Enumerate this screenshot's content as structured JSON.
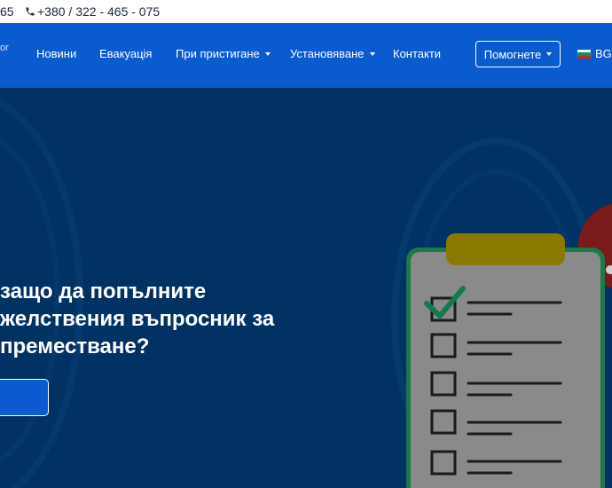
{
  "topbar": {
    "phone_fragment": "65",
    "phone": "+380 / 322 - 465 - 075"
  },
  "nav": {
    "logo_fragment": "or",
    "items": [
      {
        "label": "Новини",
        "dropdown": false
      },
      {
        "label": "Евакуація",
        "dropdown": false
      },
      {
        "label": "При пристигане",
        "dropdown": true
      },
      {
        "label": "Установяване",
        "dropdown": true
      },
      {
        "label": "Контакти",
        "dropdown": false
      }
    ],
    "help_button": "Помогнете",
    "language": "BG"
  },
  "hero": {
    "heading": "защо да попълните\nжелствения въпросник за\nпреместване?",
    "button_label": ""
  },
  "colors": {
    "nav_bg": "#0a5bd0",
    "hero_bg": "#023264",
    "clipboard_paper": "#8a8a8a",
    "clipboard_border": "#1a7a4a",
    "clipboard_clip": "#8a7a00",
    "check": "#137a4c",
    "badge": "#7a1a1a"
  },
  "icons": [
    "phone-icon",
    "caret-down-icon",
    "bulgaria-flag-icon",
    "checklist-clipboard-illustration",
    "checkmark-icon"
  ]
}
